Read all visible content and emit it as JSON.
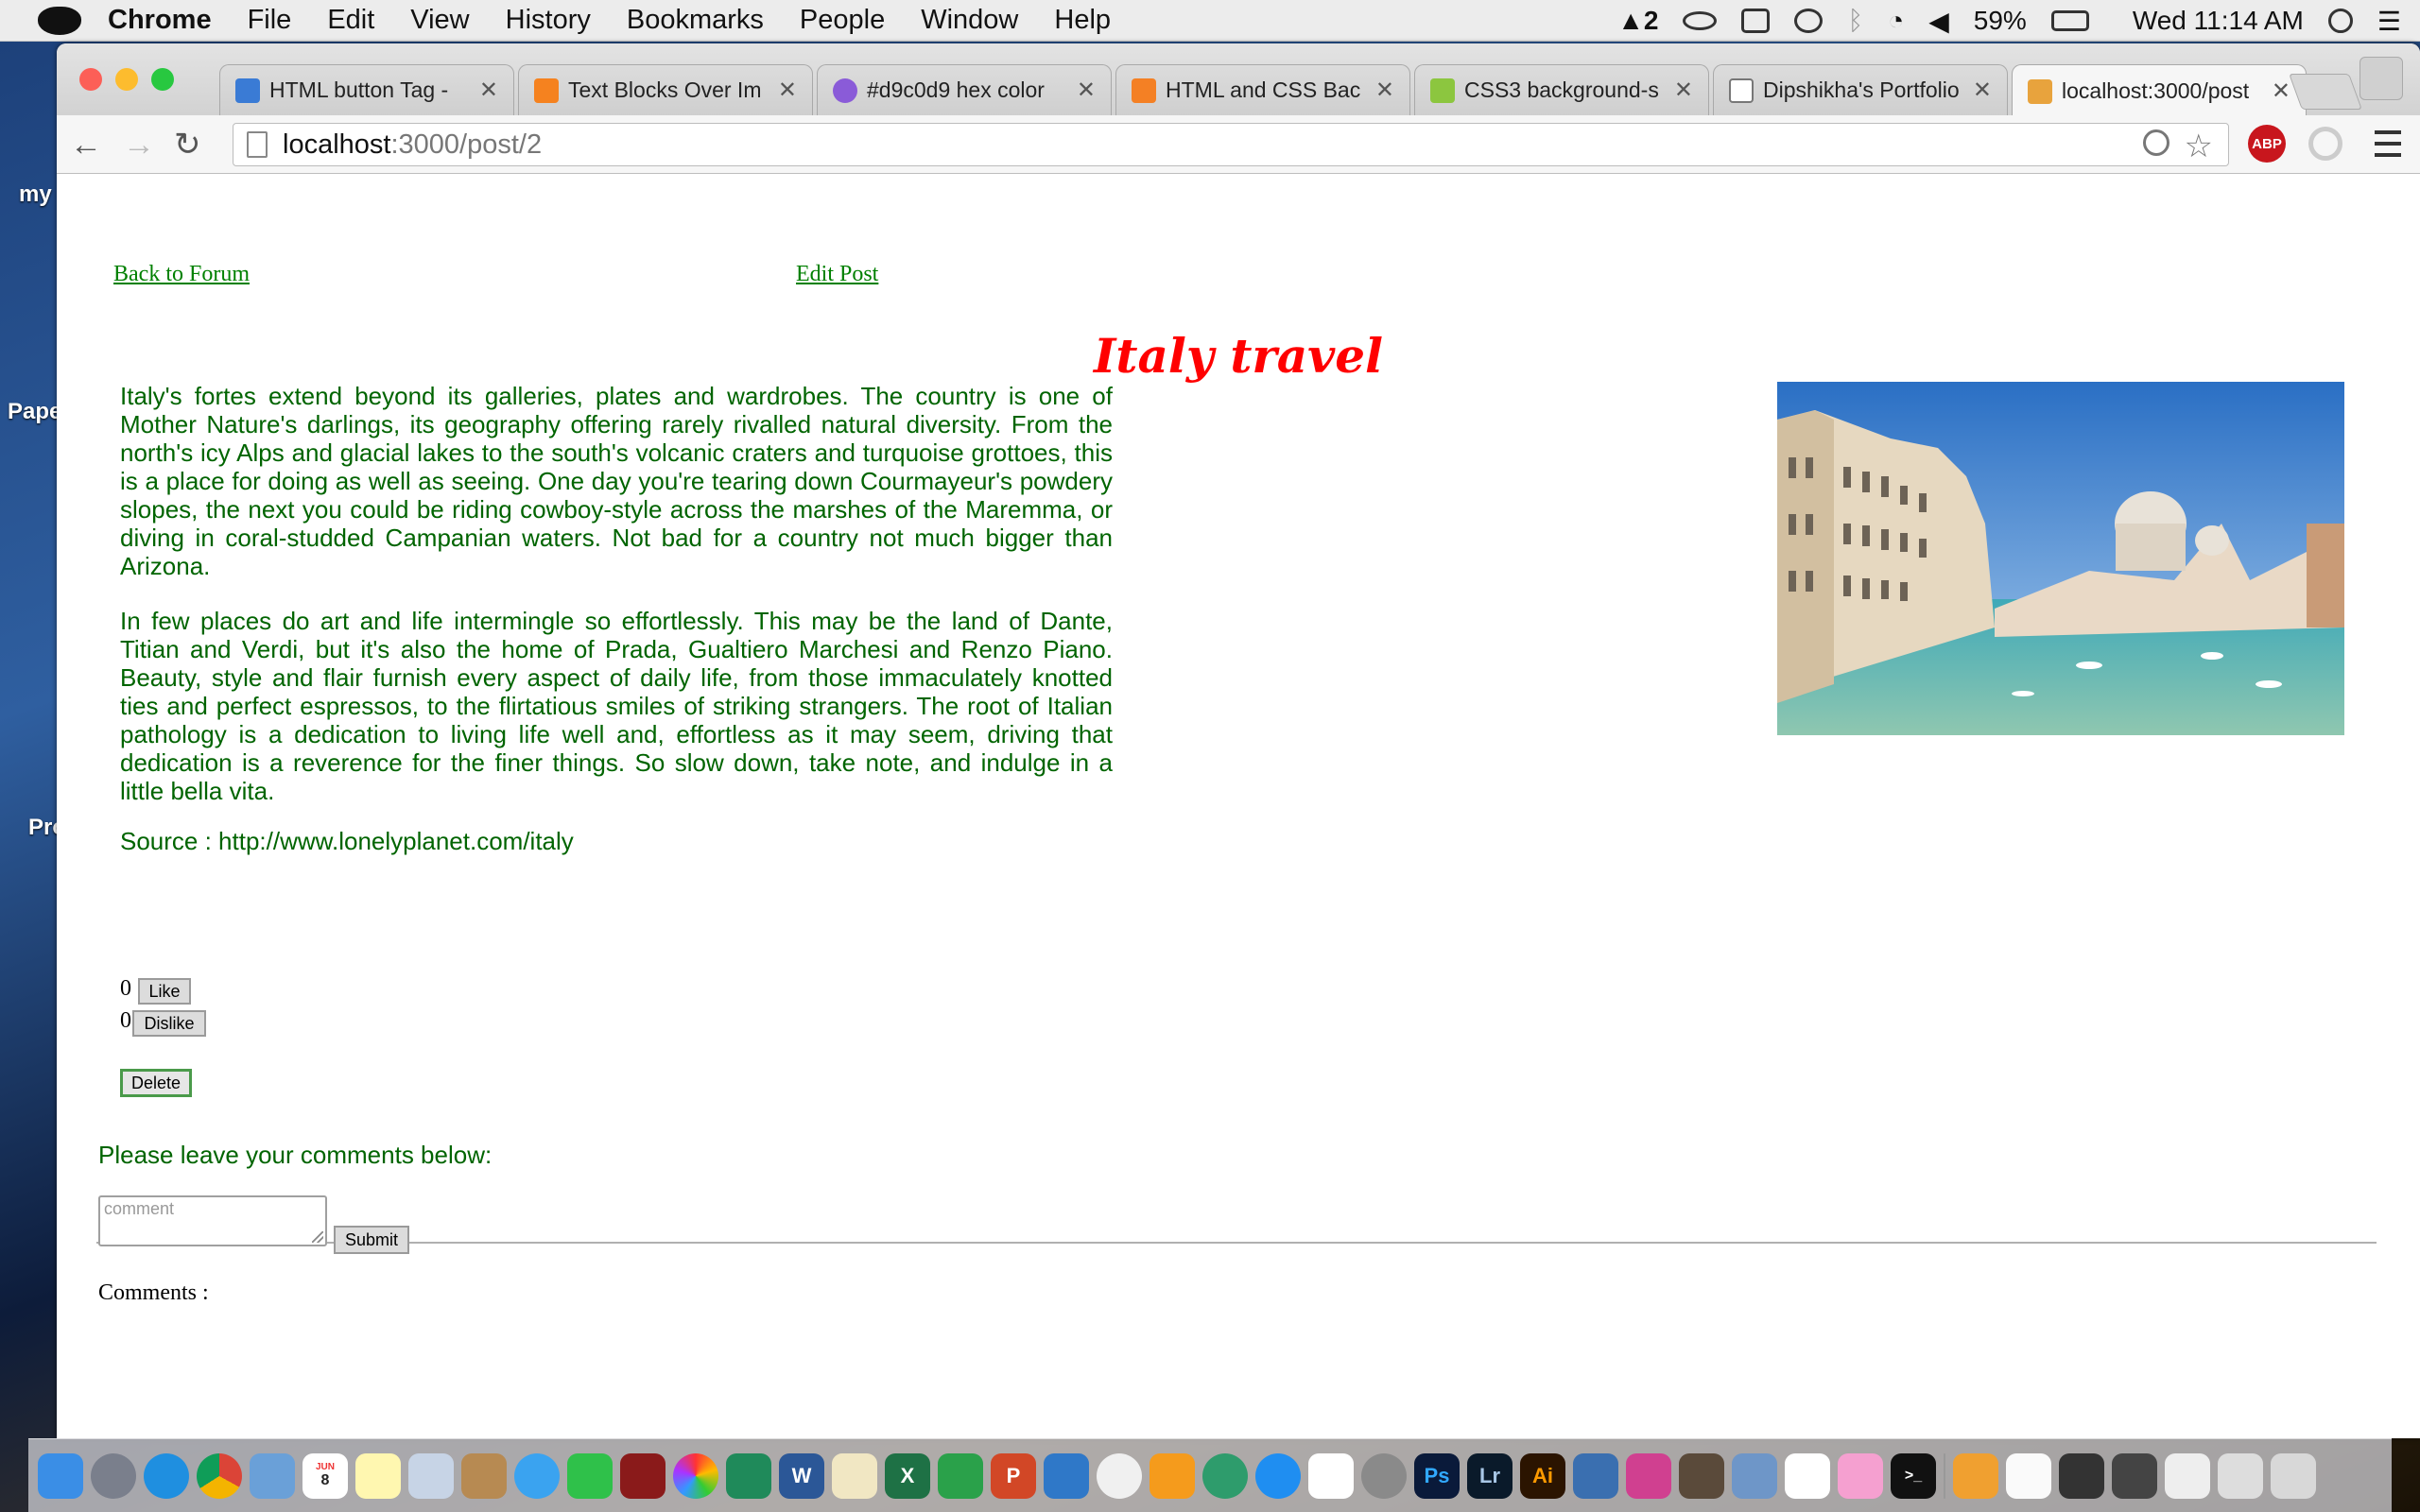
{
  "menubar": {
    "app": "Chrome",
    "items": [
      "File",
      "Edit",
      "View",
      "History",
      "Bookmarks",
      "People",
      "Window",
      "Help"
    ],
    "adobe_count": "2",
    "battery": "59%",
    "clock": "Wed 11:14 AM"
  },
  "desktop": {
    "labels": [
      "my",
      "Pape",
      "Pro"
    ]
  },
  "tabs": [
    {
      "title": "HTML button Tag - ",
      "fav": "#3a7bd5"
    },
    {
      "title": "Text Blocks Over Im",
      "fav": "#f5821f"
    },
    {
      "title": "#d9c0d9 hex color",
      "fav": "#8a5bd8"
    },
    {
      "title": "HTML and CSS Bac",
      "fav": "#f48024"
    },
    {
      "title": "CSS3 background-s",
      "fav": "#8cc63f"
    },
    {
      "title": "Dipshikha's Portfolio",
      "fav": "#ffffff"
    },
    {
      "title": "localhost:3000/post",
      "fav": "#e8a33d"
    }
  ],
  "address": {
    "host": "localhost",
    "path": ":3000/post/2"
  },
  "page": {
    "back_link": "Back to Forum",
    "edit_link": "Edit Post",
    "title": "Italy travel",
    "para1": "Italy's fortes extend beyond its galleries, plates and wardrobes. The country is one of Mother Nature's darlings, its geography offering rarely rivalled natural diversity. From the north's icy Alps and glacial lakes to the south's volcanic craters and turquoise grottoes, this is a place for doing as well as seeing. One day you're tearing down Courmayeur's powdery slopes, the next you could be riding cowboy-style across the marshes of the Maremma, or diving in coral-studded Campanian waters. Not bad for a country not much bigger than Arizona.",
    "para2": "In few places do art and life intermingle so effortlessly. This may be the land of Dante, Titian and Verdi, but it's also the home of Prada, Gualtiero Marchesi and Renzo Piano. Beauty, style and flair furnish every aspect of daily life, from those immaculately knotted ties and perfect espressos, to the flirtatious smiles of striking strangers. The root of Italian pathology is a dedication to living life well and, effortless as it may seem, driving that dedication is a reverence for the finer things. So slow down, take note, and indulge in a little bella vita.",
    "source": "Source : http://www.lonelyplanet.com/italy",
    "like_count": "0",
    "like_label": "Like",
    "dislike_count": "0",
    "dislike_label": "Dislike",
    "delete_label": "Delete",
    "comment_prompt": "Please leave your comments below:",
    "comment_placeholder": "comment",
    "submit_label": "Submit",
    "comments_heading": "Comments :"
  },
  "dock": {
    "calendar_day": "8",
    "calendar_month": "JUN",
    "apps": [
      "finder-icon",
      "launchpad-icon",
      "safari-icon",
      "chrome-icon",
      "preview-icon",
      "calendar-icon",
      "notes-icon",
      "photo-booth-icon",
      "contacts-icon",
      "messages-icon",
      "facetime-icon",
      "photo-icon",
      "photos-icon",
      "icab-icon",
      "word-icon",
      "textedit-icon",
      "excel-icon",
      "numbers-icon",
      "powerpoint-icon",
      "keynote-icon",
      "itunes-icon",
      "ibooks-icon",
      "atom-icon",
      "appstore-icon",
      "acrobat-icon",
      "system-preferences-icon",
      "photoshop-icon",
      "lightroom-icon",
      "illustrator-icon",
      "dreamweaver-icon",
      "muse-icon",
      "sublime-icon",
      "finder-docs-icon",
      "acrobat2-icon",
      "gimp-icon",
      "terminal-icon"
    ],
    "right": [
      "downloads-stack-icon",
      "folder-icon",
      "folder-icon",
      "folder-icon",
      "folder-icon",
      "trash-icon"
    ]
  }
}
